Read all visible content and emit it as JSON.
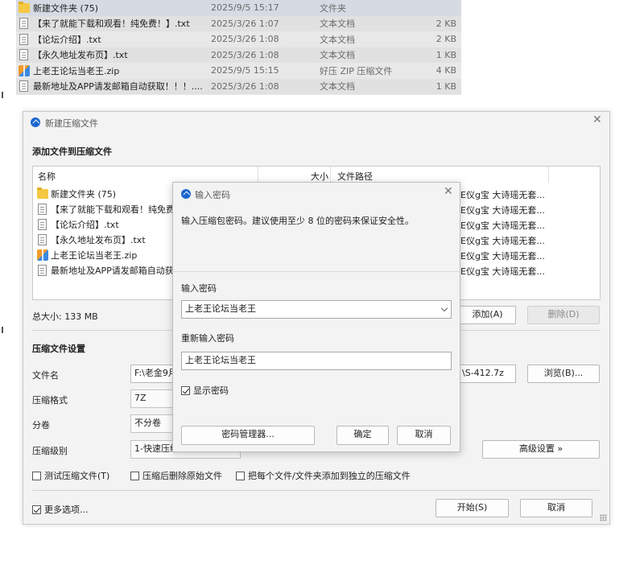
{
  "explorer": {
    "rows": [
      {
        "name": "新建文件夹 (75)",
        "date": "2025/9/5 15:17",
        "type": "文件夹",
        "size": "",
        "icon": "folder-icon"
      },
      {
        "name": "【来了就能下载和观看！纯免费！】.txt",
        "date": "2025/3/26 1:07",
        "type": "文本文档",
        "size": "2 KB",
        "icon": "text-file-icon"
      },
      {
        "name": "【论坛介绍】.txt",
        "date": "2025/3/26 1:08",
        "type": "文本文档",
        "size": "2 KB",
        "icon": "text-file-icon"
      },
      {
        "name": "【永久地址发布页】.txt",
        "date": "2025/3/26 1:08",
        "type": "文本文档",
        "size": "1 KB",
        "icon": "text-file-icon"
      },
      {
        "name": "上老王论坛当老王.zip",
        "date": "2025/9/5 15:15",
        "type": "好压 ZIP 压缩文件",
        "size": "4 KB",
        "icon": "zip-file-icon"
      },
      {
        "name": "最新地址及APP请发邮箱自动获取！！！....",
        "date": "2025/3/26 1:08",
        "type": "文本文档",
        "size": "1 KB",
        "icon": "text-file-icon"
      }
    ]
  },
  "main": {
    "title": "新建压缩文件",
    "section_add": "添加文件到压缩文件",
    "columns": {
      "name": "名称",
      "size": "大小",
      "path": "文件路径"
    },
    "files": [
      {
        "name": "新建文件夹 (75)",
        "path_tail": "E仪g宝 大诗瑶无套...",
        "icon": "folder-icon"
      },
      {
        "name": "【来了就能下载和观看！纯免费",
        "path_tail": "E仪g宝 大诗瑶无套...",
        "icon": "text-file-icon"
      },
      {
        "name": "【论坛介绍】.txt",
        "path_tail": "E仪g宝 大诗瑶无套...",
        "icon": "text-file-icon"
      },
      {
        "name": "【永久地址发布页】.txt",
        "path_tail": "E仪g宝 大诗瑶无套...",
        "icon": "text-file-icon"
      },
      {
        "name": "上老王论坛当老王.zip",
        "path_tail": "E仪g宝 大诗瑶无套...",
        "icon": "zip-file-icon"
      },
      {
        "name": "最新地址及APP请发邮箱自动获",
        "path_tail": "E仪g宝 大诗瑶无套...",
        "icon": "text-file-icon"
      }
    ],
    "total_size": "总大小: 133 MB",
    "add_button": "添加(A)",
    "delete_button": "删除(D)",
    "section_settings": "压缩文件设置",
    "filename_label": "文件名",
    "filename_value_left": "F:\\老金9月",
    "filename_value_right": "\\S-412.7z",
    "browse_button": "浏览(B)...",
    "format_label": "压缩格式",
    "format_value": "7Z",
    "volume_label": "分卷",
    "volume_value": "不分卷",
    "level_label": "压缩级别",
    "level_value": "1-快速压缩",
    "advanced_button": "高级设置 »",
    "options": {
      "test": "测试压缩文件(T)",
      "delete_after": "压缩后删除原始文件",
      "separate": "把每个文件/文件夹添加到独立的压缩文件"
    },
    "more_options": "更多选项...",
    "start_button": "开始(S)",
    "cancel_button": "取消"
  },
  "pwd": {
    "title": "输入密码",
    "hint": "输入压缩包密码。建议使用至少 8 位的密码来保证安全性。",
    "password_label": "输入密码",
    "password_value": "上老王论坛当老王",
    "repeat_label": "重新输入密码",
    "repeat_value": "上老王论坛当老王",
    "show_password": "显示密码",
    "manager_button": "密码管理器...",
    "ok_button": "确定",
    "cancel_button": "取消"
  }
}
